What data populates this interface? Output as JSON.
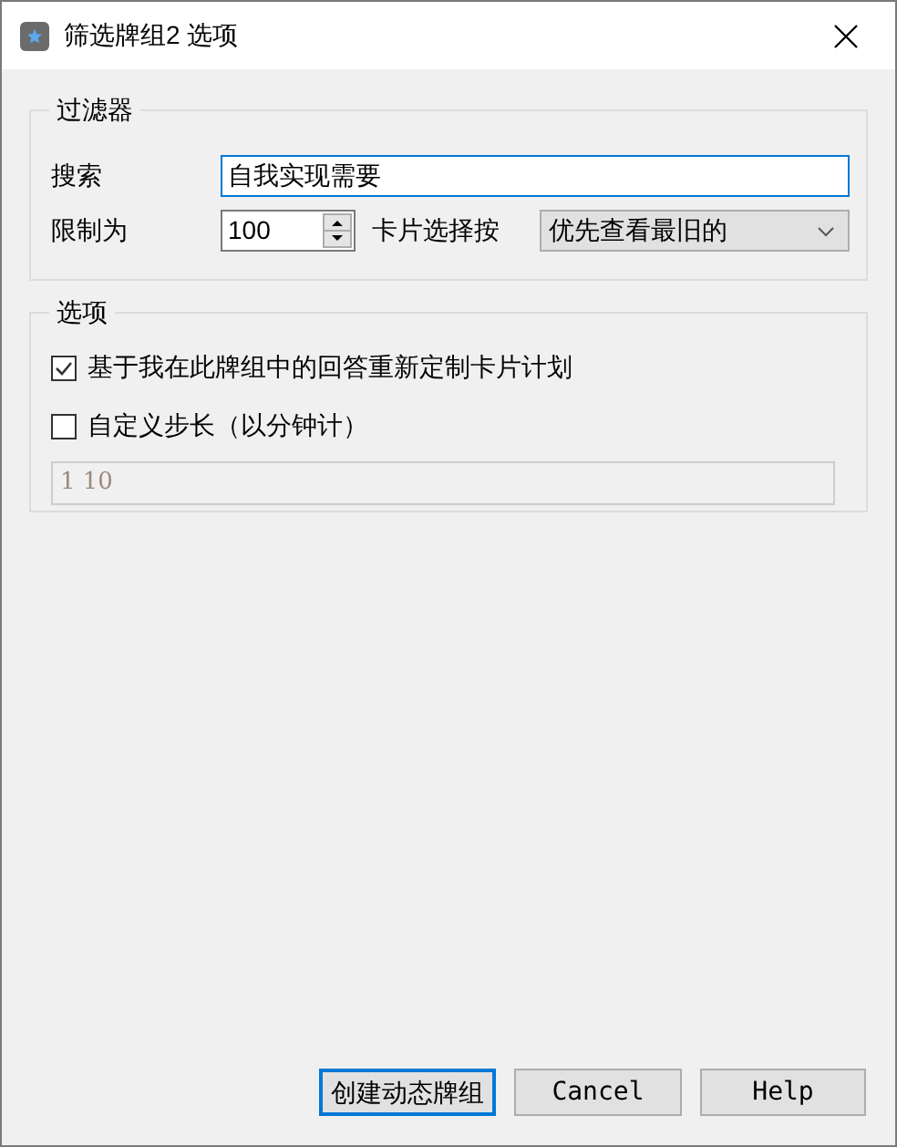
{
  "window": {
    "title": "筛选牌组2 选项"
  },
  "filter": {
    "legend": "过滤器",
    "search_label": "搜索",
    "search_value": "自我实现需要",
    "limit_label": "限制为",
    "limit_value": "100",
    "order_label": "卡片选择按",
    "order_value": "优先查看最旧的"
  },
  "options": {
    "legend": "选项",
    "checkboxes": [
      {
        "label": "基于我在此牌组中的回答重新定制卡片计划",
        "checked": true
      },
      {
        "label": "自定义步长（以分钟计）",
        "checked": false
      }
    ],
    "steps": {
      "value": "1 10",
      "disabled": true
    }
  },
  "buttons": [
    {
      "label": "创建动态牌组",
      "default": true
    },
    {
      "label": "Cancel",
      "default": false
    },
    {
      "label": "Help",
      "default": false
    }
  ]
}
